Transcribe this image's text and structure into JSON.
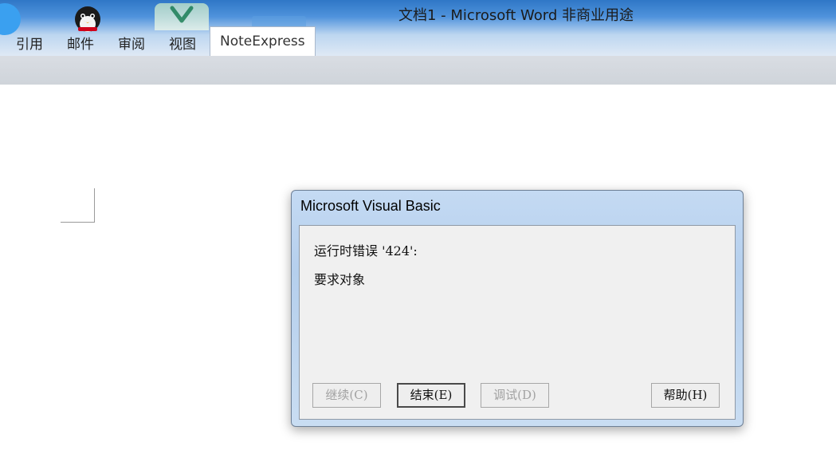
{
  "window": {
    "title": "文档1 - Microsoft Word 非商业用途"
  },
  "ribbon": {
    "tabs": [
      {
        "label": "引用"
      },
      {
        "label": "邮件"
      },
      {
        "label": "审阅"
      },
      {
        "label": "视图"
      },
      {
        "label": "NoteExpress",
        "active": true
      }
    ]
  },
  "dialog": {
    "title": "Microsoft Visual Basic",
    "message_line1": "运行时错误 '424':",
    "message_line2": "要求对象",
    "buttons": {
      "continue": {
        "label": "继续(C)",
        "enabled": false
      },
      "end": {
        "label": "结束(E)",
        "enabled": true,
        "default": true
      },
      "debug": {
        "label": "调试(D)",
        "enabled": false
      },
      "help": {
        "label": "帮助(H)",
        "enabled": true
      }
    }
  }
}
